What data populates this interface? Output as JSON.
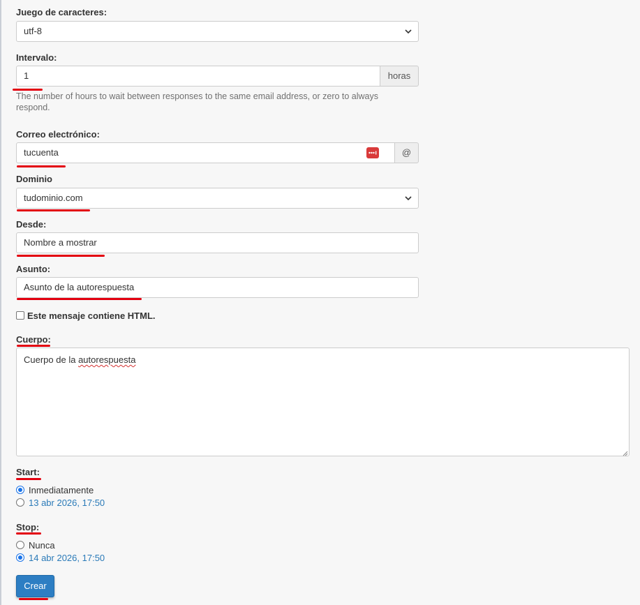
{
  "charset": {
    "label": "Juego de caracteres:",
    "value": "utf-8"
  },
  "interval": {
    "label": "Intervalo:",
    "value": "1",
    "addon": "horas",
    "help": "The number of hours to wait between responses to the same email address, or zero to always respond."
  },
  "email": {
    "label": "Correo electrónico:",
    "value": "tucuenta",
    "addon": "@"
  },
  "domain": {
    "label": "Dominio",
    "value": "tudominio.com"
  },
  "from": {
    "label": "Desde:",
    "value": "Nombre a mostrar"
  },
  "subject": {
    "label": "Asunto:",
    "value": "Asunto de la autorespuesta"
  },
  "html_checkbox": {
    "label": "Este mensaje contiene HTML.",
    "checked": false
  },
  "body": {
    "label": "Cuerpo:",
    "value_prefix": "Cuerpo de la ",
    "value_misspelled": "autorespuesta"
  },
  "start": {
    "label": "Start:",
    "options": [
      {
        "label": "Inmediatamente",
        "checked": true
      },
      {
        "label": "13 abr 2026, 17:50",
        "checked": false
      }
    ]
  },
  "stop": {
    "label": "Stop:",
    "options": [
      {
        "label": "Nunca",
        "checked": false
      },
      {
        "label": "14 abr 2026, 17:50",
        "checked": true
      }
    ]
  },
  "submit": {
    "label": "Crear"
  },
  "colors": {
    "accent": "#2d7ec3",
    "annotation": "#e3000f",
    "password_manager": "#d93a3a"
  },
  "icons": {
    "select_arrow": "chevron-down-icon",
    "password_manager": "password-manager-icon"
  }
}
